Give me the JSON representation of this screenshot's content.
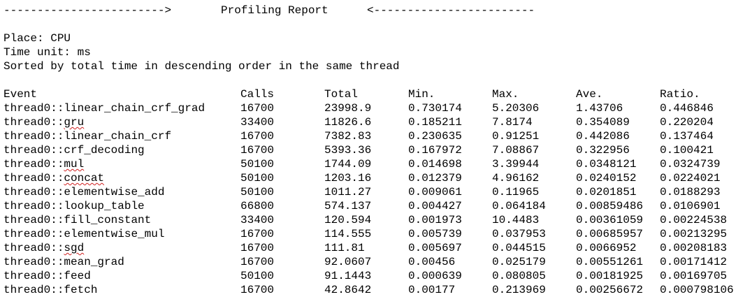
{
  "banner": {
    "left_arrow": "------------------------>",
    "title": "Profiling Report",
    "right_arrow": "<------------------------"
  },
  "meta": {
    "place": "Place: CPU",
    "time_unit": "Time unit: ms",
    "sort_note": "Sorted by total time in descending order in the same thread"
  },
  "table": {
    "headers": [
      "Event",
      "Calls",
      "Total",
      "Min.",
      "Max.",
      "Ave.",
      "Ratio."
    ],
    "rows": [
      {
        "prefix": "thread0::",
        "name": "linear_chain_crf_grad",
        "calls": "16700",
        "total": "23998.9",
        "min": "0.730174",
        "max": "5.20306",
        "ave": "1.43706",
        "ratio": "0.446846"
      },
      {
        "prefix": "thread0::",
        "name": "gru",
        "calls": "33400",
        "total": "11826.6",
        "min": "0.185211",
        "max": "7.8174",
        "ave": "0.354089",
        "ratio": "0.220204"
      },
      {
        "prefix": "thread0::",
        "name": "linear_chain_crf",
        "calls": "16700",
        "total": "7382.83",
        "min": "0.230635",
        "max": "0.91251",
        "ave": "0.442086",
        "ratio": "0.137464"
      },
      {
        "prefix": "thread0::",
        "name": "crf_decoding",
        "calls": "16700",
        "total": "5393.36",
        "min": "0.167972",
        "max": "7.08867",
        "ave": "0.322956",
        "ratio": "0.100421"
      },
      {
        "prefix": "thread0::",
        "name": "mul",
        "calls": "50100",
        "total": "1744.09",
        "min": "0.014698",
        "max": "3.39944",
        "ave": "0.0348121",
        "ratio": "0.0324739"
      },
      {
        "prefix": "thread0::",
        "name": "concat",
        "calls": "50100",
        "total": "1203.16",
        "min": "0.012379",
        "max": "4.96162",
        "ave": "0.0240152",
        "ratio": "0.0224021"
      },
      {
        "prefix": "thread0::",
        "name": "elementwise_add",
        "calls": "50100",
        "total": "1011.27",
        "min": "0.009061",
        "max": "0.11965",
        "ave": "0.0201851",
        "ratio": "0.0188293"
      },
      {
        "prefix": "thread0::",
        "name": "lookup_table",
        "calls": "66800",
        "total": "574.137",
        "min": "0.004427",
        "max": "0.064184",
        "ave": "0.00859486",
        "ratio": "0.0106901"
      },
      {
        "prefix": "thread0::",
        "name": "fill_constant",
        "calls": "33400",
        "total": "120.594",
        "min": "0.001973",
        "max": "10.4483",
        "ave": "0.00361059",
        "ratio": "0.00224538"
      },
      {
        "prefix": "thread0::",
        "name": "elementwise_mul",
        "calls": "16700",
        "total": "114.555",
        "min": "0.005739",
        "max": "0.037953",
        "ave": "0.00685957",
        "ratio": "0.00213295"
      },
      {
        "prefix": "thread0::",
        "name": "sgd",
        "calls": "16700",
        "total": "111.81",
        "min": "0.005697",
        "max": "0.044515",
        "ave": "0.0066952",
        "ratio": "0.00208183"
      },
      {
        "prefix": "thread0::",
        "name": "mean_grad",
        "calls": "16700",
        "total": "92.0607",
        "min": "0.00456",
        "max": "0.025179",
        "ave": "0.00551261",
        "ratio": "0.00171412"
      },
      {
        "prefix": "thread0::",
        "name": "feed",
        "calls": "50100",
        "total": "91.1443",
        "min": "0.000639",
        "max": "0.080805",
        "ave": "0.00181925",
        "ratio": "0.00169705"
      },
      {
        "prefix": "thread0::",
        "name": "fetch",
        "calls": "16700",
        "total": "42.8642",
        "min": "0.00177",
        "max": "0.213969",
        "ave": "0.00256672",
        "ratio": "0.000798106"
      }
    ]
  }
}
